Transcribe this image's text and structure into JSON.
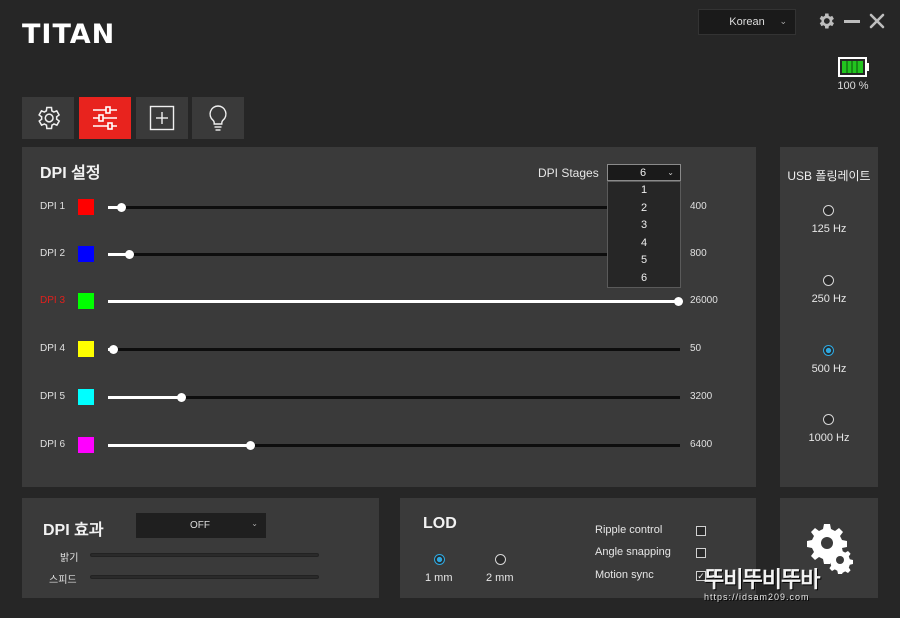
{
  "app": {
    "logo": "TITAN"
  },
  "header": {
    "language": "Korean",
    "battery_text": "100 %",
    "battery_level": 1.0
  },
  "tabs": [
    {
      "name": "settings",
      "icon": "gear-icon",
      "active": false
    },
    {
      "name": "dpi",
      "icon": "sliders-icon",
      "active": true
    },
    {
      "name": "macro",
      "icon": "plus-box-icon",
      "active": false
    },
    {
      "name": "lighting",
      "icon": "bulb-icon",
      "active": false
    }
  ],
  "dpi_panel": {
    "title": "DPI 설정",
    "stages_label": "DPI Stages",
    "stages_value": "6",
    "stages_options": [
      "1",
      "2",
      "3",
      "4",
      "5",
      "6"
    ],
    "rows": [
      {
        "label": "DPI 1",
        "color": "#ff0000",
        "value": "400",
        "fraction": 0.019,
        "active": false
      },
      {
        "label": "DPI 2",
        "color": "#0000ff",
        "value": "800",
        "fraction": 0.033,
        "active": false
      },
      {
        "label": "DPI 3",
        "color": "#00ff00",
        "value": "26000",
        "fraction": 1.0,
        "active": true
      },
      {
        "label": "DPI 4",
        "color": "#ffff00",
        "value": "50",
        "fraction": 0.006,
        "active": false
      },
      {
        "label": "DPI 5",
        "color": "#00ffff",
        "value": "3200",
        "fraction": 0.125,
        "active": false
      },
      {
        "label": "DPI 6",
        "color": "#ff00ff",
        "value": "6400",
        "fraction": 0.247,
        "active": false
      }
    ]
  },
  "usb_panel": {
    "title": "USB 폴링레이트",
    "options": [
      {
        "label": "125 Hz",
        "selected": false
      },
      {
        "label": "250 Hz",
        "selected": false
      },
      {
        "label": "500 Hz",
        "selected": true
      },
      {
        "label": "1000 Hz",
        "selected": false
      }
    ]
  },
  "effect_panel": {
    "title": "DPI 효과",
    "mode": "OFF",
    "brightness_label": "밝기",
    "speed_label": "스피드"
  },
  "lod_panel": {
    "title": "LOD",
    "options": [
      {
        "label": "1 mm",
        "selected": true
      },
      {
        "label": "2 mm",
        "selected": false
      }
    ],
    "checks": [
      {
        "label": "Ripple control",
        "checked": false
      },
      {
        "label": "Angle snapping",
        "checked": false
      },
      {
        "label": "Motion sync",
        "checked": true
      }
    ]
  },
  "watermark": {
    "text": "뚜비뚜비뚜바",
    "url": "https://idsam209.com"
  },
  "colors": {
    "accent": "#e8231e",
    "panel": "#3a3a3a",
    "background": "#262626",
    "radio_on": "#2ea8e0"
  }
}
